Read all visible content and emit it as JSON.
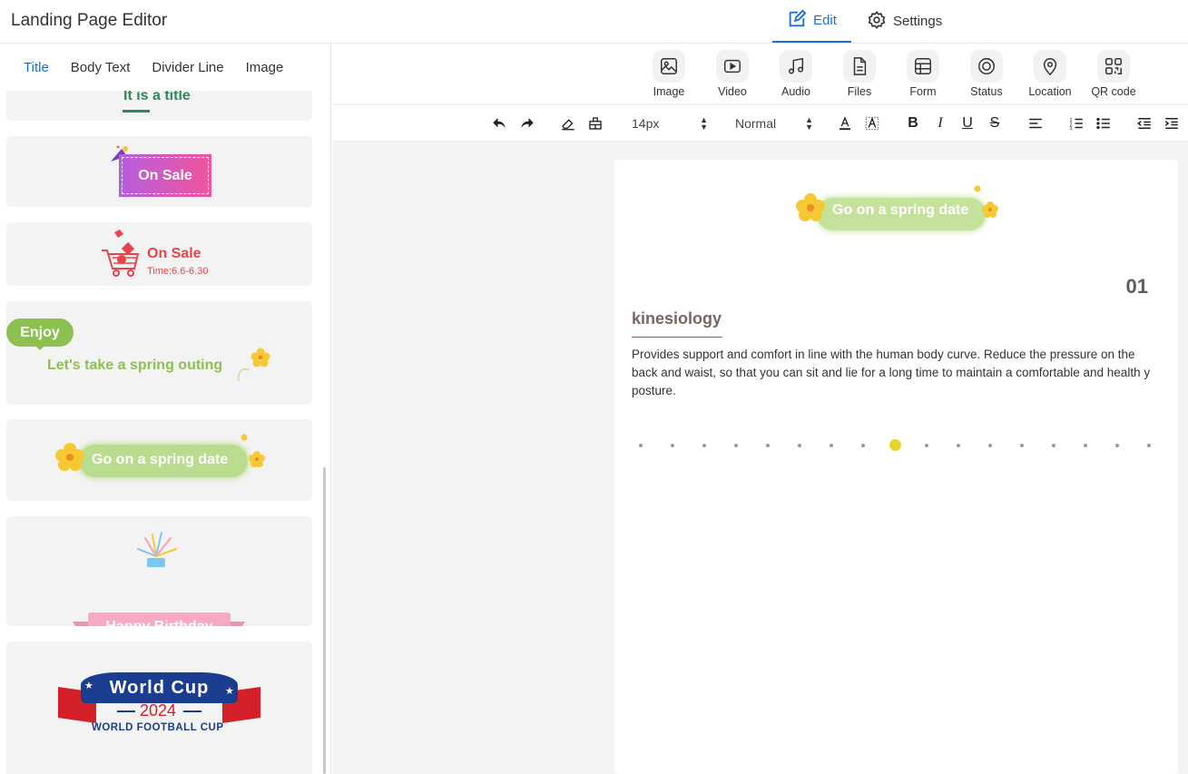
{
  "app": {
    "title": "Landing Page Editor",
    "top_tabs": [
      {
        "label": "Edit",
        "active": true,
        "icon": "edit-icon"
      },
      {
        "label": "Settings",
        "active": false,
        "icon": "gear-icon"
      }
    ],
    "accent_color": "#1a6fd6"
  },
  "sidebar": {
    "tabs": [
      {
        "label": "Title",
        "active": true
      },
      {
        "label": "Body Text",
        "active": false
      },
      {
        "label": "Divider Line",
        "active": false
      },
      {
        "label": "Image",
        "active": false
      }
    ],
    "templates": [
      {
        "text": "It is a title"
      },
      {
        "text": "On Sale"
      },
      {
        "text": "On Sale",
        "subtext": "Time:6.6-6.30"
      },
      {
        "tag": "Enjoy",
        "text": "Let's take a spring outing"
      },
      {
        "text": "Go on a spring date"
      },
      {
        "text": "Happy Birthday"
      },
      {
        "text": "World Cup",
        "year": "2024",
        "subtext": "WORLD FOOTBALL CUP"
      }
    ]
  },
  "insert_bar": {
    "items": [
      {
        "label": "Image",
        "icon": "image-icon"
      },
      {
        "label": "Video",
        "icon": "video-icon"
      },
      {
        "label": "Audio",
        "icon": "audio-icon"
      },
      {
        "label": "Files",
        "icon": "file-icon"
      },
      {
        "label": "Form",
        "icon": "form-icon"
      },
      {
        "label": "Status",
        "icon": "status-icon"
      },
      {
        "label": "Location",
        "icon": "location-icon"
      },
      {
        "label": "QR code",
        "icon": "qr-code-icon"
      }
    ]
  },
  "format_bar": {
    "font_size": "14px",
    "block_style": "Normal"
  },
  "canvas": {
    "banner_text": "Go on a spring date",
    "number": "01",
    "heading": "kinesiology",
    "body": "Provides support and comfort in line with the human body curve. Reduce the pressure on the back and waist, so that you can sit and lie for a long time to maintain a comfortable and health y posture.",
    "pagination": {
      "count": 17,
      "active_index": 8,
      "active_color": "#e6d52c"
    }
  }
}
